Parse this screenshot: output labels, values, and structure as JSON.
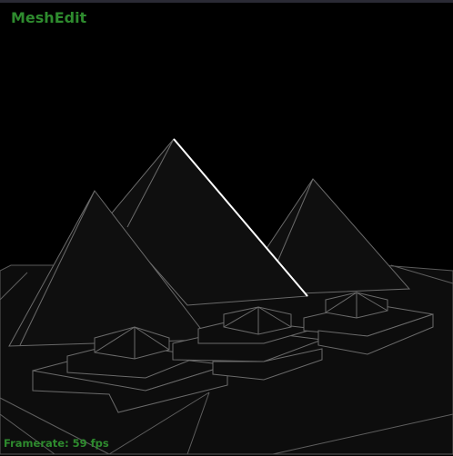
{
  "app": {
    "title": "MeshEdit"
  },
  "hud": {
    "framerate_text": "Framerate: 59 fps"
  },
  "scene": {
    "background_color": "#000000",
    "fill_color": "#0d0d0d",
    "wire_color": "#6a6a6a",
    "highlight_color": "#ffffff",
    "hud_color": "#2e8b2e",
    "selection": "edge"
  }
}
